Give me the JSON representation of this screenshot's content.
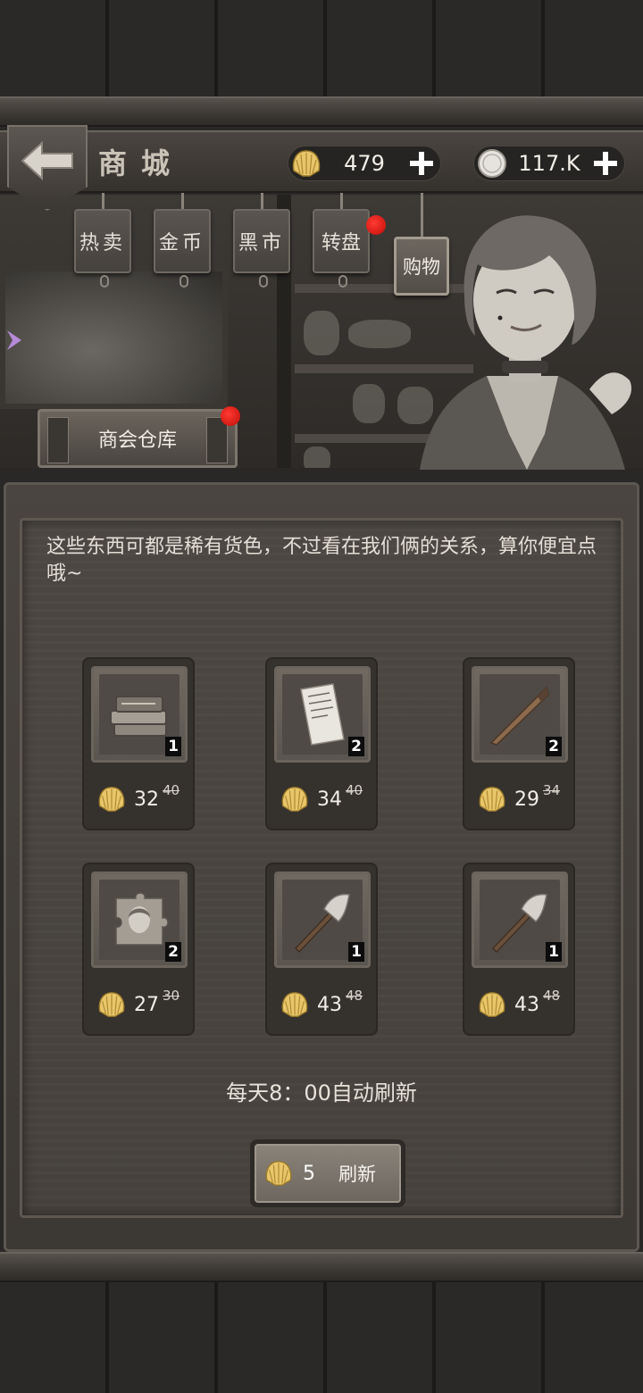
{
  "header": {
    "title": "商城",
    "shells": "479",
    "coins": "117.K"
  },
  "tabs": [
    {
      "label": "热卖"
    },
    {
      "label": "金币"
    },
    {
      "label": "黑市"
    },
    {
      "label": "转盘",
      "badge": true
    },
    {
      "label": "购物",
      "active": true
    }
  ],
  "warehouse": {
    "label": "商会仓库",
    "badge": true
  },
  "dialogue": "这些东西可都是稀有货色，不过看在我们俩的关系，算你便宜点哦~",
  "items": [
    {
      "icon": "books-icon",
      "qty": "1",
      "price": "32",
      "old_price": "40"
    },
    {
      "icon": "paper-note-icon",
      "qty": "2",
      "price": "34",
      "old_price": "40"
    },
    {
      "icon": "stake-icon",
      "qty": "2",
      "price": "29",
      "old_price": "34"
    },
    {
      "icon": "puzzle-portrait-icon",
      "qty": "2",
      "price": "27",
      "old_price": "30"
    },
    {
      "icon": "axe-icon",
      "qty": "1",
      "price": "43",
      "old_price": "48"
    },
    {
      "icon": "axe-icon",
      "qty": "1",
      "price": "43",
      "old_price": "48"
    }
  ],
  "refresh": {
    "note": "每天8：00自动刷新",
    "cost": "5",
    "label": "刷新"
  },
  "colors": {
    "badge": "#e0140f",
    "panel": "#47423d",
    "text": "#e8e4dc"
  }
}
